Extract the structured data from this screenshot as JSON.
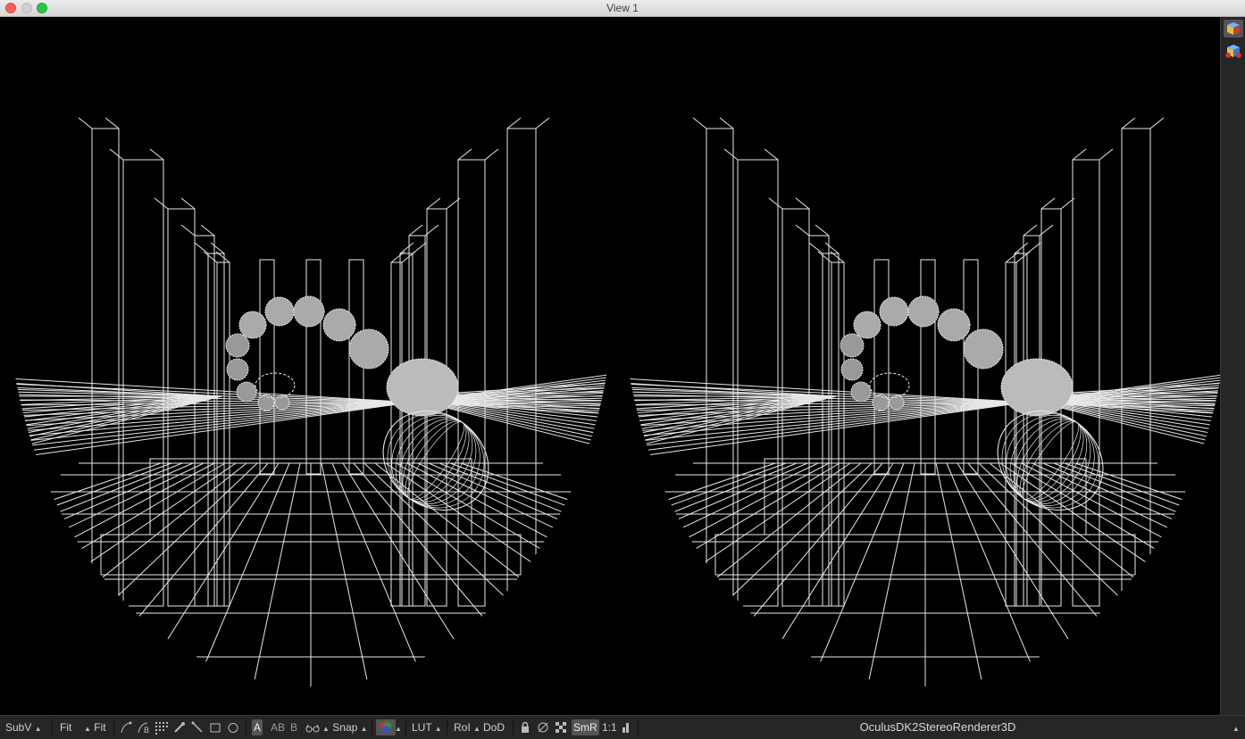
{
  "window": {
    "title": "View 1"
  },
  "toolbar": {
    "subv": "SubV",
    "fit1": "Fit",
    "fit2": "Fit",
    "a": "A",
    "ab": "AB",
    "b": "B",
    "snap": "Snap",
    "lut": "LUT",
    "roi": "RoI",
    "dod": "DoD",
    "smr": "SmR",
    "scale": "1:1",
    "renderer": "OculusDK2StereoRenderer3D"
  },
  "colors": {
    "wire": "#e8e8e8",
    "bg": "#000000",
    "panel": "#262626"
  }
}
